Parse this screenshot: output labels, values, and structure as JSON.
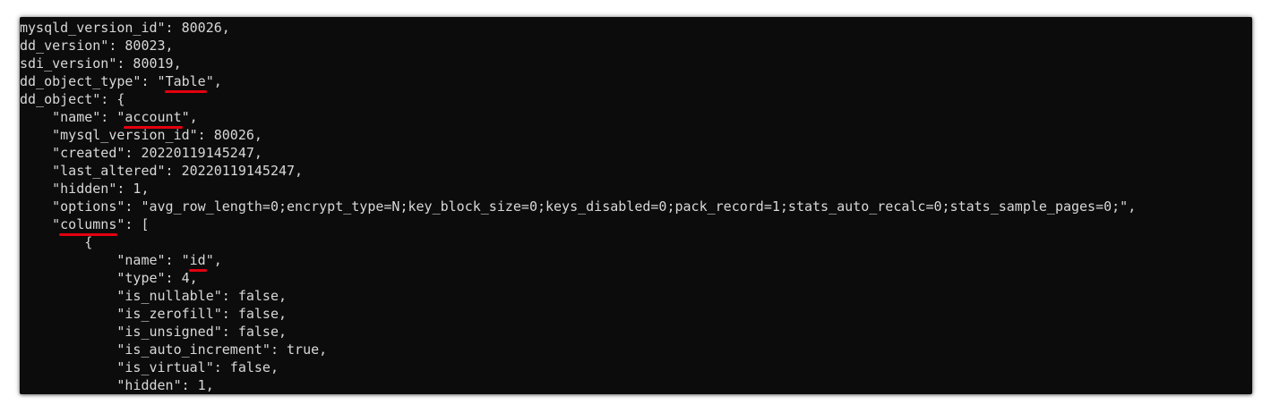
{
  "console": {
    "lines": [
      {
        "before": "mysqld_version_id\": 80026,",
        "mark": "",
        "after": ""
      },
      {
        "before": "dd_version\": 80023,",
        "mark": "",
        "after": ""
      },
      {
        "before": "sdi_version\": 80019,",
        "mark": "",
        "after": ""
      },
      {
        "before": "dd_object_type\": \"",
        "mark": "Table",
        "after": "\","
      },
      {
        "before": "dd_object\": {",
        "mark": "",
        "after": ""
      },
      {
        "before": "    \"name\": \"",
        "mark": "account",
        "after": "\","
      },
      {
        "before": "    \"mysql_version_id\": 80026,",
        "mark": "",
        "after": ""
      },
      {
        "before": "    \"created\": 20220119145247,",
        "mark": "",
        "after": ""
      },
      {
        "before": "    \"last_altered\": 20220119145247,",
        "mark": "",
        "after": ""
      },
      {
        "before": "    \"hidden\": 1,",
        "mark": "",
        "after": ""
      },
      {
        "before": "    \"options\": \"avg_row_length=0;encrypt_type=N;key_block_size=0;keys_disabled=0;pack_record=1;stats_auto_recalc=0;stats_sample_pages=0;\",",
        "mark": "",
        "after": ""
      },
      {
        "before": "    \"",
        "mark": "columns",
        "after": "\": ["
      },
      {
        "before": "        {",
        "mark": "",
        "after": ""
      },
      {
        "before": "            \"name\": \"",
        "mark": "id",
        "after": "\","
      },
      {
        "before": "            \"type\": 4,",
        "mark": "",
        "after": ""
      },
      {
        "before": "            \"is_nullable\": false,",
        "mark": "",
        "after": ""
      },
      {
        "before": "            \"is_zerofill\": false,",
        "mark": "",
        "after": ""
      },
      {
        "before": "            \"is_unsigned\": false,",
        "mark": "",
        "after": ""
      },
      {
        "before": "            \"is_auto_increment\": true,",
        "mark": "",
        "after": ""
      },
      {
        "before": "            \"is_virtual\": false,",
        "mark": "",
        "after": ""
      },
      {
        "before": "            \"hidden\": 1,",
        "mark": "",
        "after": ""
      }
    ]
  },
  "colors": {
    "background": "#0c0c0c",
    "text": "#d8d8d8",
    "underline": "#e4000f"
  }
}
